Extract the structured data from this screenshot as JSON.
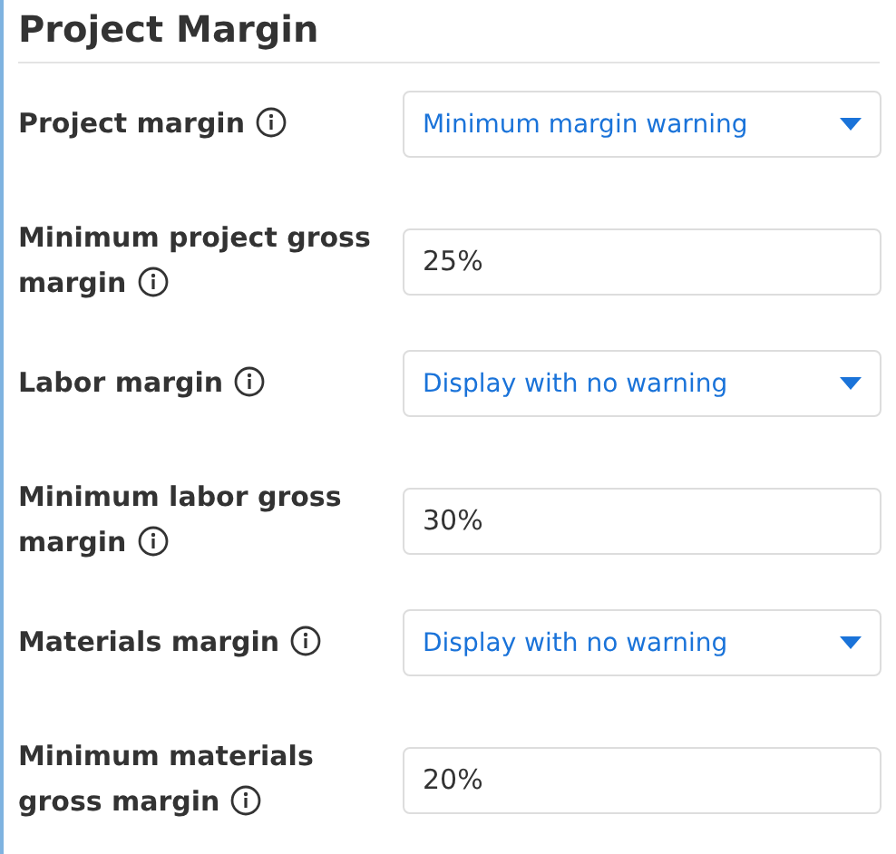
{
  "title": "Project Margin",
  "fields": [
    {
      "kind": "select",
      "label": "Project margin",
      "value": "Minimum margin warning"
    },
    {
      "kind": "input",
      "label": "Minimum project gross margin",
      "value": "25%"
    },
    {
      "kind": "select",
      "label": "Labor margin",
      "value": "Display with no warning"
    },
    {
      "kind": "input",
      "label": "Minimum labor gross margin",
      "value": "30%"
    },
    {
      "kind": "select",
      "label": "Materials margin",
      "value": "Display with no warning"
    },
    {
      "kind": "input",
      "label": "Minimum materials gross margin",
      "value": "20%"
    }
  ]
}
